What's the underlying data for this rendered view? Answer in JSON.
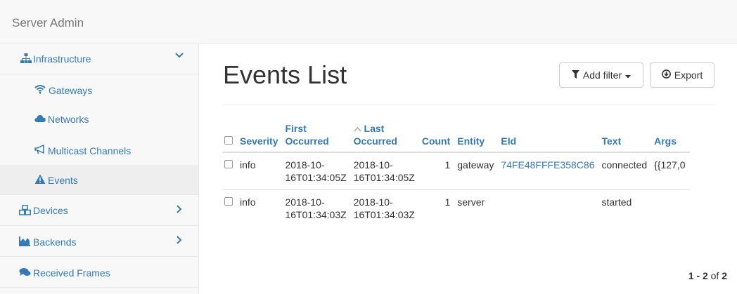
{
  "app": {
    "brand": "Server Admin"
  },
  "sidebar": {
    "infrastructure": {
      "label": "Infrastructure",
      "icon": "sitemap-icon"
    },
    "sub": [
      {
        "label": "Gateways",
        "icon": "wifi-icon"
      },
      {
        "label": "Networks",
        "icon": "cloud-icon"
      },
      {
        "label": "Multicast Channels",
        "icon": "bullhorn-icon"
      },
      {
        "label": "Events",
        "icon": "warning-icon"
      }
    ],
    "devices": {
      "label": "Devices",
      "icon": "cubes-icon"
    },
    "backends": {
      "label": "Backends",
      "icon": "area-chart-icon"
    },
    "received": {
      "label": "Received Frames",
      "icon": "comments-icon"
    }
  },
  "main": {
    "title": "Events List",
    "add_filter": "Add filter",
    "export": "Export",
    "table": {
      "headers": {
        "severity": "Severity",
        "first_line1": "First",
        "first_line2": "Occurred",
        "last_line1": "Last",
        "last_line2": "Occurred",
        "count": "Count",
        "entity": "Entity",
        "eid": "EId",
        "text": "Text",
        "args": "Args"
      },
      "rows": [
        {
          "severity": "info",
          "first_a": "2018-10-",
          "first_b": "16T01:34:05Z",
          "last_a": "2018-10-",
          "last_b": "16T01:34:05Z",
          "count": "1",
          "entity": "gateway",
          "eid": "74FE48FFFE358C86",
          "text": "connected",
          "args": "{{127,0"
        },
        {
          "severity": "info",
          "first_a": "2018-10-",
          "first_b": "16T01:34:03Z",
          "last_a": "2018-10-",
          "last_b": "16T01:34:03Z",
          "count": "1",
          "entity": "server",
          "eid": "",
          "text": "started",
          "args": ""
        }
      ]
    },
    "pager": {
      "range": "1 - 2",
      "of": "of",
      "total": "2"
    }
  }
}
